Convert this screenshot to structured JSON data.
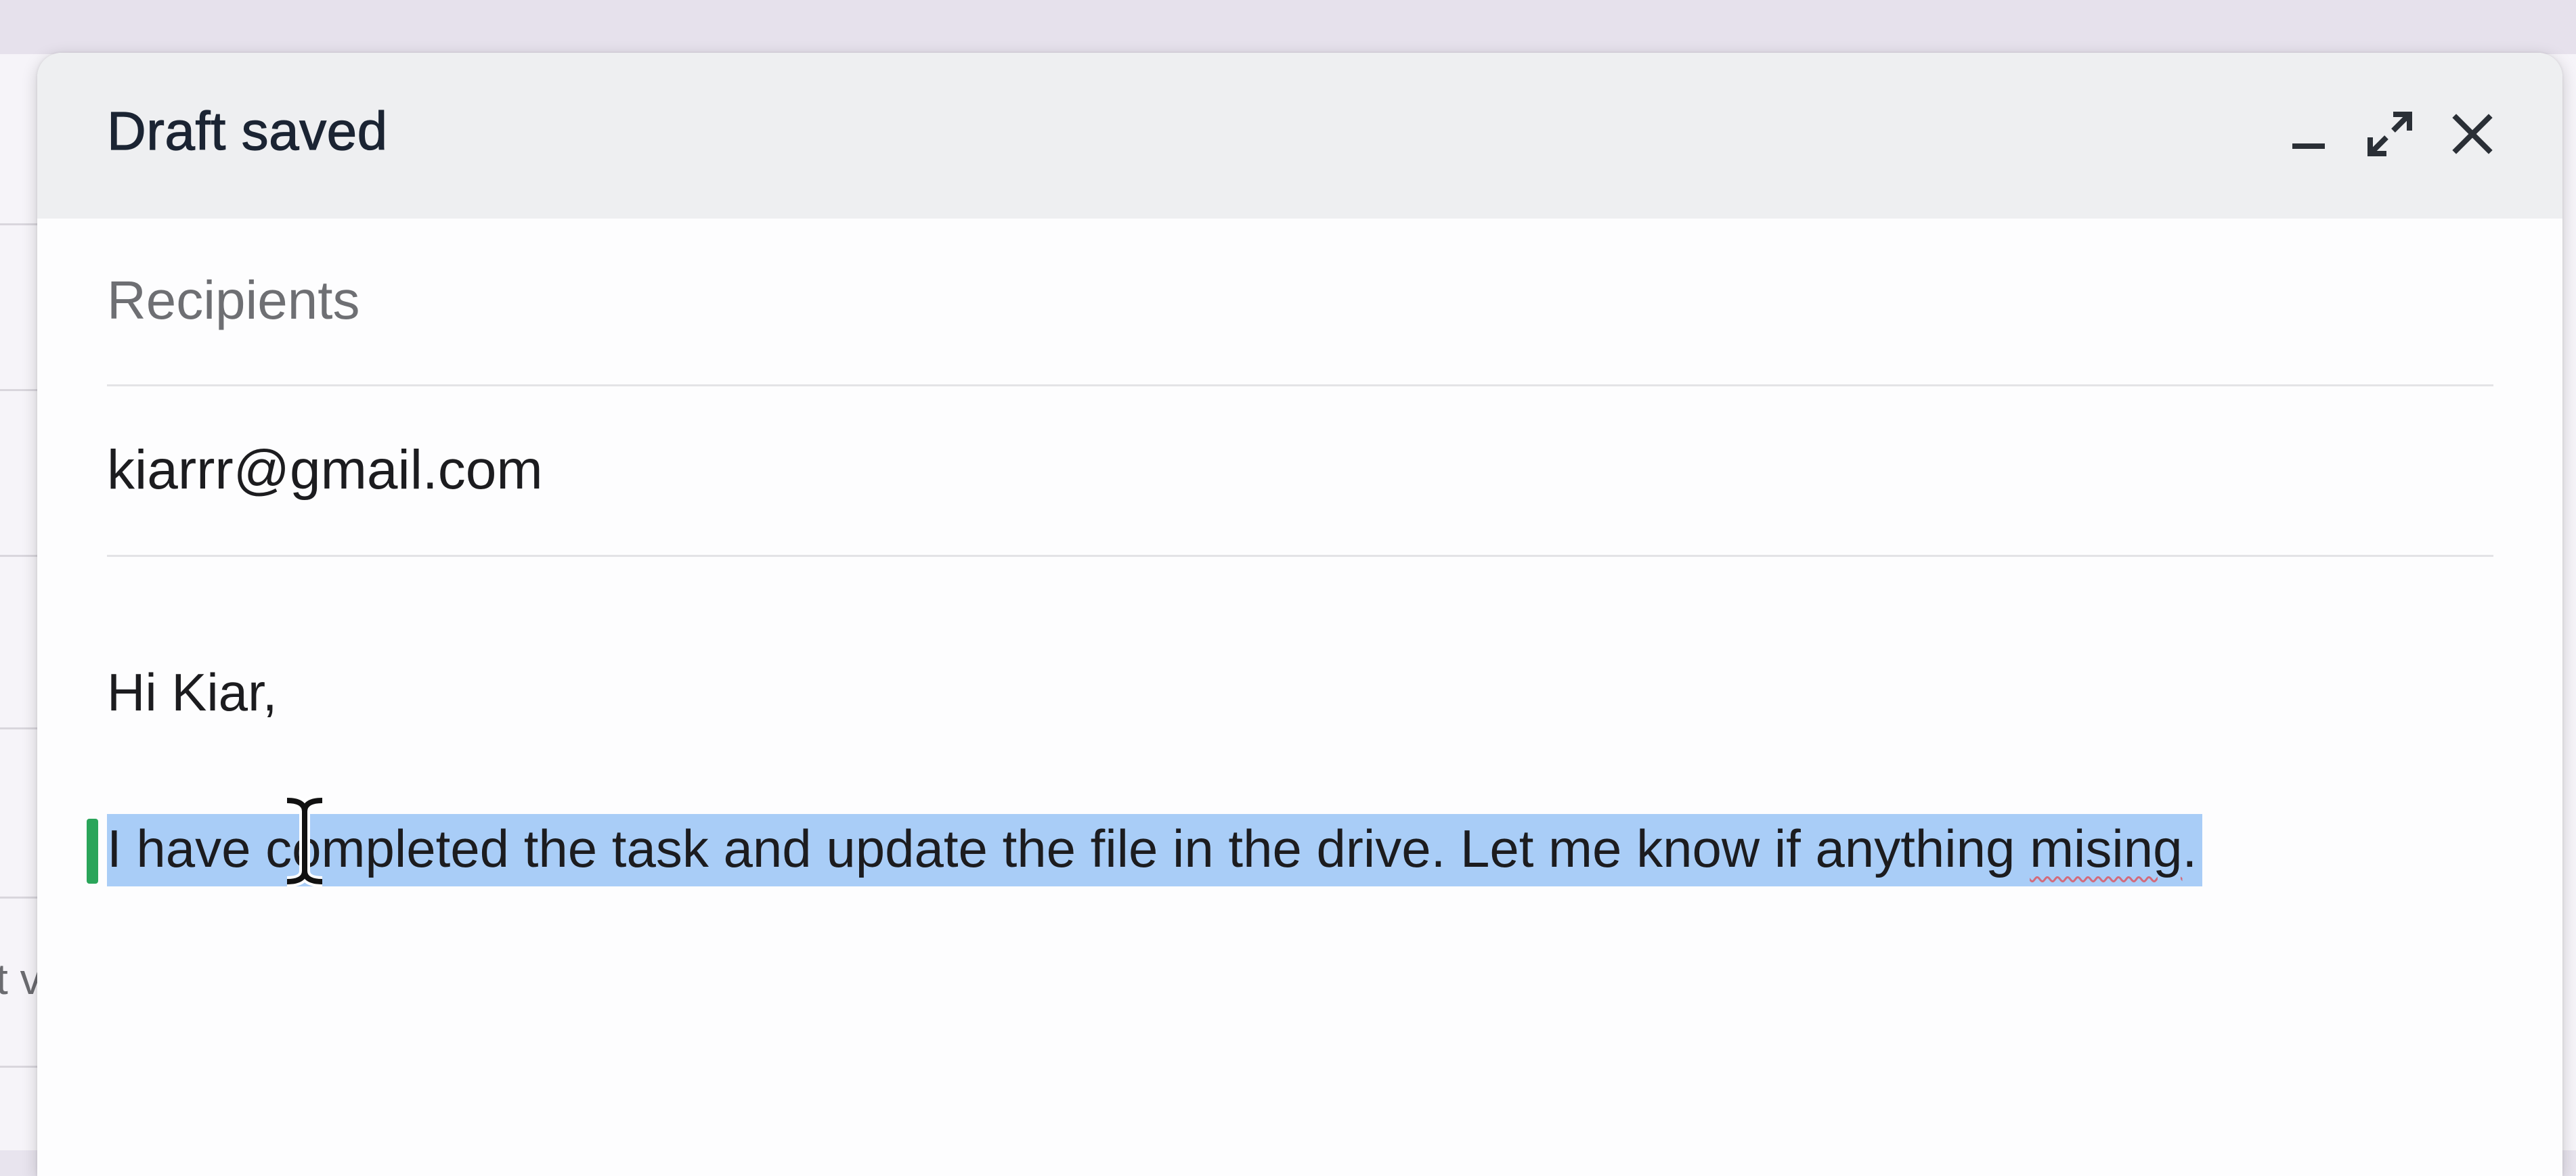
{
  "compose": {
    "title": "Draft saved",
    "controls": {
      "minimize_icon": "minimize-icon",
      "expand_icon": "expand-icon",
      "close_icon": "close-icon"
    },
    "recipients_placeholder": "Recipients",
    "to_value": "kiarrr@gmail.com",
    "body": {
      "greeting": "Hi Kiar,",
      "selected_text_before_misspelling": "I have completed the task and update the file in the drive. Let me know if anything ",
      "misspelled_word": "mising",
      "selected_text_after_misspelling": "."
    }
  },
  "background": {
    "edge_fragment_text": "t v"
  },
  "colors": {
    "header_bg": "#eeeff1",
    "selection": "#a9cdf7",
    "caret_marker": "#2aa55a",
    "spellcheck_underline": "#d36a7b"
  }
}
